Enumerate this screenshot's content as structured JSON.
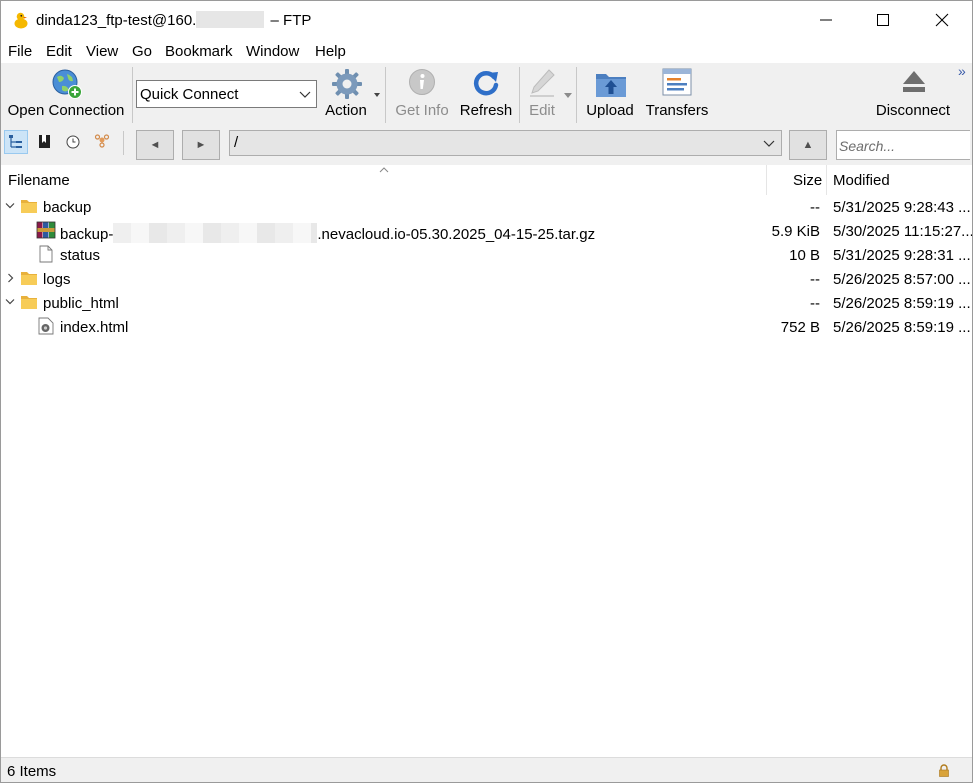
{
  "window": {
    "title_prefix": "dinda123_ftp-test@160.",
    "title_suffix": "– FTP",
    "controls": {
      "minimize": "minimize",
      "maximize": "maximize",
      "close": "close"
    }
  },
  "menu": [
    "File",
    "Edit",
    "View",
    "Go",
    "Bookmark",
    "Window",
    "Help"
  ],
  "toolbar": {
    "open_connection": "Open Connection",
    "quick_connect": "Quick Connect",
    "action": "Action",
    "get_info": "Get Info",
    "refresh": "Refresh",
    "edit": "Edit",
    "upload": "Upload",
    "transfers": "Transfers",
    "disconnect": "Disconnect",
    "overflow": "»"
  },
  "navigation": {
    "back": "◄",
    "forward": "►",
    "path": "/",
    "up": "▲",
    "search_placeholder": "Search..."
  },
  "columns": {
    "filename": "Filename",
    "size": "Size",
    "modified": "Modified"
  },
  "files": [
    {
      "name": "backup",
      "size": "--",
      "modified": "5/31/2025 9:28:43 ...",
      "type": "folder",
      "expanded": true
    },
    {
      "name_prefix": "backup-",
      "name_suffix": ".nevacloud.io-05.30.2025_04-15-25.tar.gz",
      "size": "5.9 KiB",
      "modified": "5/30/2025 11:15:27...",
      "type": "archive"
    },
    {
      "name": "status",
      "size": "10 B",
      "modified": "5/31/2025 9:28:31 ...",
      "type": "file"
    },
    {
      "name": "logs",
      "size": "--",
      "modified": "5/26/2025 8:57:00 ...",
      "type": "folder",
      "expanded": false
    },
    {
      "name": "public_html",
      "size": "--",
      "modified": "5/26/2025 8:59:19 ...",
      "type": "folder",
      "expanded": true
    },
    {
      "name": "index.html",
      "size": "752 B",
      "modified": "5/26/2025 8:59:19 ...",
      "type": "html"
    }
  ],
  "status": {
    "items": "6 Items"
  },
  "colors": {
    "folder": "#f4c542",
    "accent": "#0078d7",
    "toolbar_bg": "#f0f0f0"
  }
}
